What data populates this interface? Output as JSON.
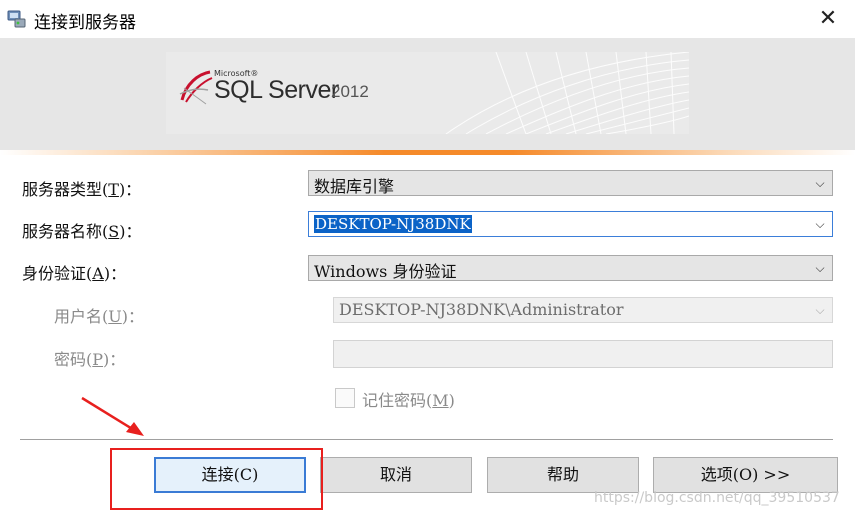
{
  "window": {
    "title": "连接到服务器",
    "close_glyph": "✕",
    "icon": "server-connect-icon"
  },
  "banner": {
    "microsoft": "Microsoft®",
    "product": "SQL Server",
    "year": "2012"
  },
  "form": {
    "server_type": {
      "label": "服务器类型",
      "mnemonic": "T",
      "value": "数据库引擎"
    },
    "server_name": {
      "label": "服务器名称",
      "mnemonic": "S",
      "value": "DESKTOP-NJ38DNK"
    },
    "auth": {
      "label": "身份验证",
      "mnemonic": "A",
      "value": "Windows 身份验证"
    },
    "username": {
      "label": "用户名",
      "mnemonic": "U",
      "value": "DESKTOP-NJ38DNK\\Administrator"
    },
    "password": {
      "label": "密码",
      "mnemonic": "P",
      "value": ""
    },
    "remember": {
      "label": "记住密码",
      "mnemonic": "M",
      "checked": false
    }
  },
  "buttons": {
    "connect": "连接(C)",
    "cancel": "取消",
    "help": "帮助",
    "options": "选项(O) >>"
  },
  "watermark": "https://blog.csdn.net/qq_39510537",
  "colors": {
    "accent_orange": "#f58a2a",
    "selection_blue": "#0b63c7",
    "annotation_red": "#e8201e"
  }
}
